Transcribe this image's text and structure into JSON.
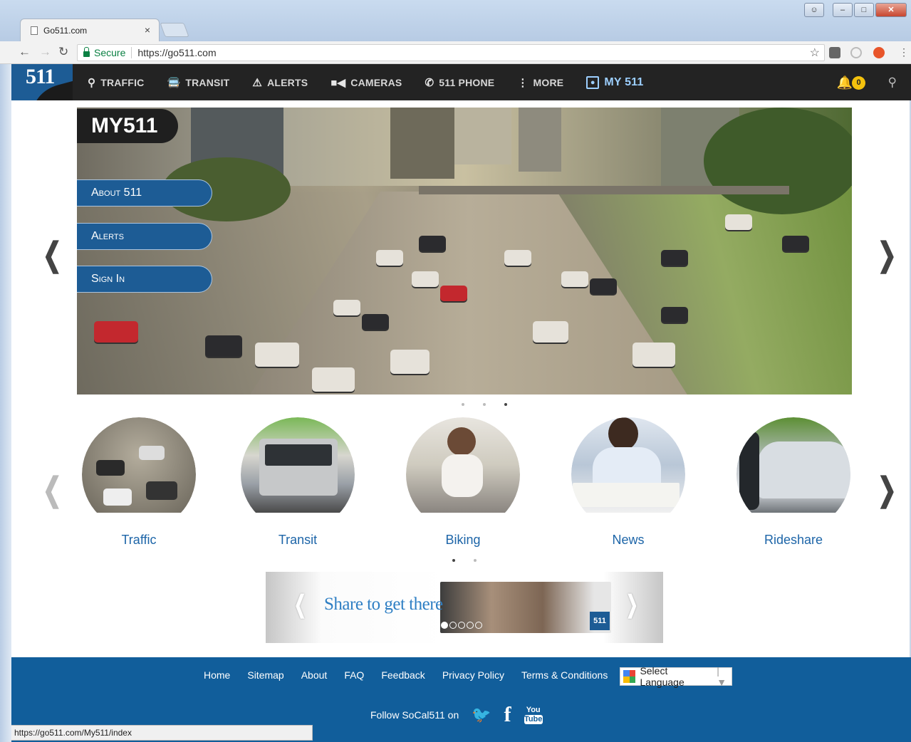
{
  "browser": {
    "tab_title": "Go511.com",
    "tab_close": "×",
    "secure_label": "Secure",
    "url": "https://go511.com",
    "status_url": "https://go511.com/My511/index"
  },
  "site": {
    "logo_text": "511",
    "nav": [
      {
        "label": "TRAFFIC",
        "icon": "map-pin-icon"
      },
      {
        "label": "TRANSIT",
        "icon": "bus-icon"
      },
      {
        "label": "ALERTS",
        "icon": "warning-icon"
      },
      {
        "label": "CAMERAS",
        "icon": "camera-icon"
      },
      {
        "label": "511 PHONE",
        "icon": "phone-icon"
      },
      {
        "label": "MORE",
        "icon": "kebab-icon"
      },
      {
        "label": "MY 511",
        "icon": "user-icon"
      }
    ],
    "notification_count": "0"
  },
  "hero": {
    "title": "MY511",
    "menu": [
      "About 511",
      "Alerts",
      "Sign In"
    ],
    "active_slide": 3,
    "slide_count": 3
  },
  "categories": {
    "items": [
      "Traffic",
      "Transit",
      "Biking",
      "News",
      "Rideshare"
    ],
    "active_page": 1,
    "page_count": 2
  },
  "banner": {
    "text": "Share to get there",
    "logo": "511"
  },
  "footer": {
    "links": [
      "Home",
      "Sitemap",
      "About",
      "FAQ",
      "Feedback",
      "Privacy Policy",
      "Terms & Conditions"
    ],
    "language_select": "Select Language",
    "follow_text": "Follow SoCal511 on",
    "youtube_top": "You",
    "youtube_bottom": "Tube"
  }
}
